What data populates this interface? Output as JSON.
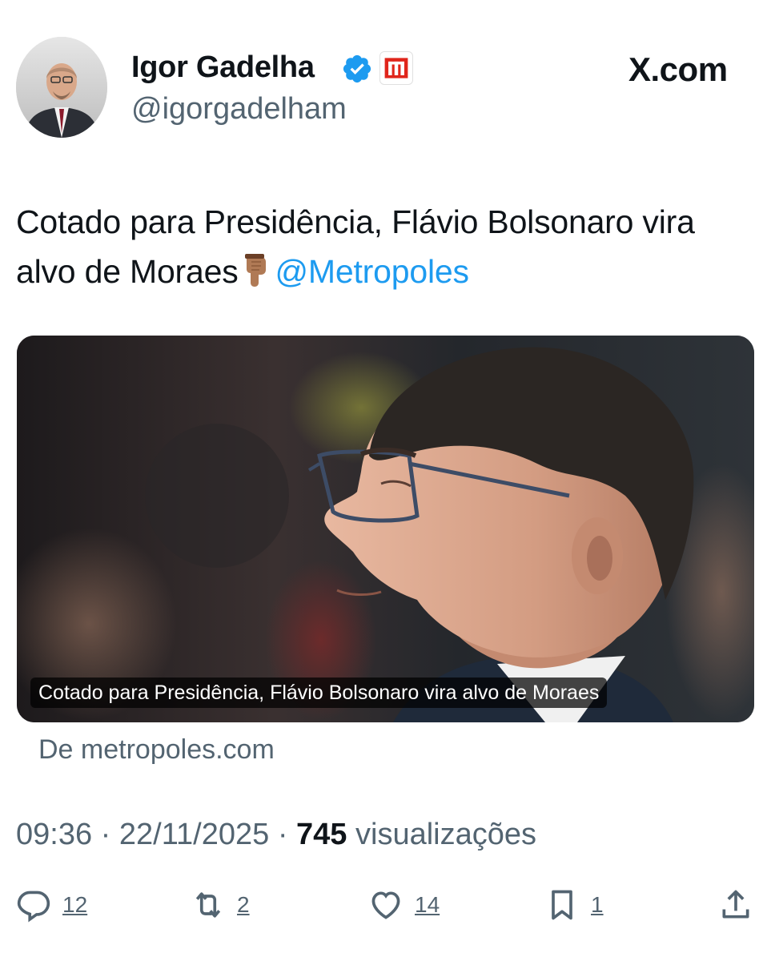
{
  "header": {
    "name": "Igor Gadelha",
    "handle": "@igorgadelham",
    "site_label": "X.com",
    "verified_icon": "verified-badge-icon",
    "affiliation_icon": "metropoles-logo-icon"
  },
  "tweet": {
    "text_before_mention": "Cotado para Presidência, Flávio Bolsonaro vira alvo de Moraes",
    "emoji": "pointing-down-icon",
    "mention": "@Metropoles"
  },
  "card": {
    "caption": "Cotado para Presidência, Flávio Bolsonaro vira alvo de Moraes",
    "source": "De metropoles.com"
  },
  "meta": {
    "time": "09:36",
    "separator": "·",
    "date": "22/11/2025",
    "views_count": "745",
    "views_label": "visualizações"
  },
  "actions": {
    "replies": "12",
    "reposts": "2",
    "likes": "14",
    "bookmarks": "1"
  },
  "colors": {
    "accent": "#1d9bf0",
    "secondary_text": "#536471",
    "primary_text": "#0f1419",
    "badge_red": "#e0251b"
  }
}
